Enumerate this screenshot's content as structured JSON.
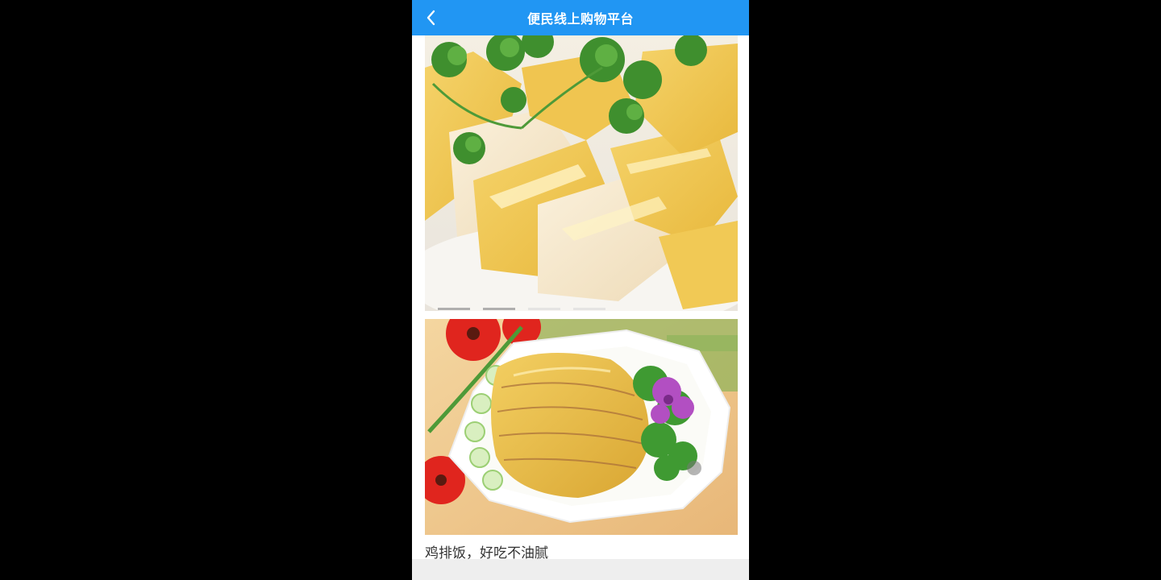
{
  "header": {
    "title": "便民线上购物平台",
    "back_icon": "chevron-left-icon"
  },
  "main": {
    "images": [
      {
        "name": "chicken-with-cilantro",
        "description_icon": "photo"
      },
      {
        "name": "sliced-chicken-plate",
        "description_icon": "photo"
      }
    ],
    "caption": "鸡排饭，好吃不油腻"
  },
  "colors": {
    "header_bg": "#2196f3",
    "caption_text": "#333333",
    "page_bg": "#000000"
  }
}
